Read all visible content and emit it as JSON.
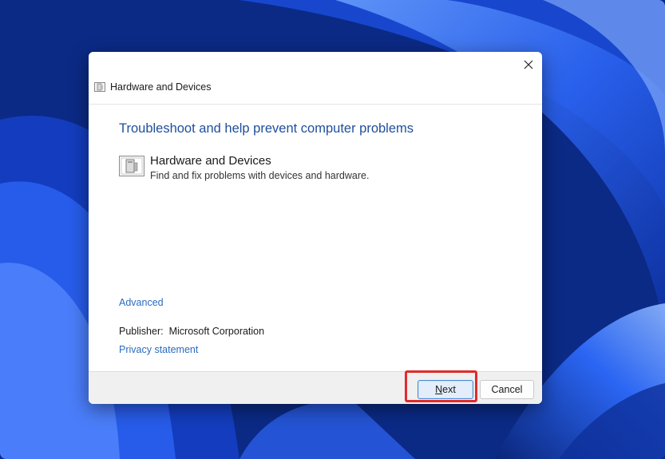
{
  "window": {
    "title": "Hardware and Devices",
    "close_glyph": "✕"
  },
  "content": {
    "heading": "Troubleshoot and help prevent computer problems",
    "item": {
      "title": "Hardware and Devices",
      "description": "Find and fix problems with devices and hardware.",
      "icon": "hardware-devices-icon"
    },
    "advanced_link": "Advanced",
    "publisher_label": "Publisher:",
    "publisher_value": "Microsoft Corporation",
    "privacy_link": "Privacy statement"
  },
  "footer": {
    "next_first": "N",
    "next_rest": "ext",
    "cancel_label": "Cancel"
  },
  "colors": {
    "heading": "#1f4e9c",
    "link": "#2a6bbf",
    "highlight": "#e02b2b",
    "wallpaper": "#1f55e6"
  }
}
